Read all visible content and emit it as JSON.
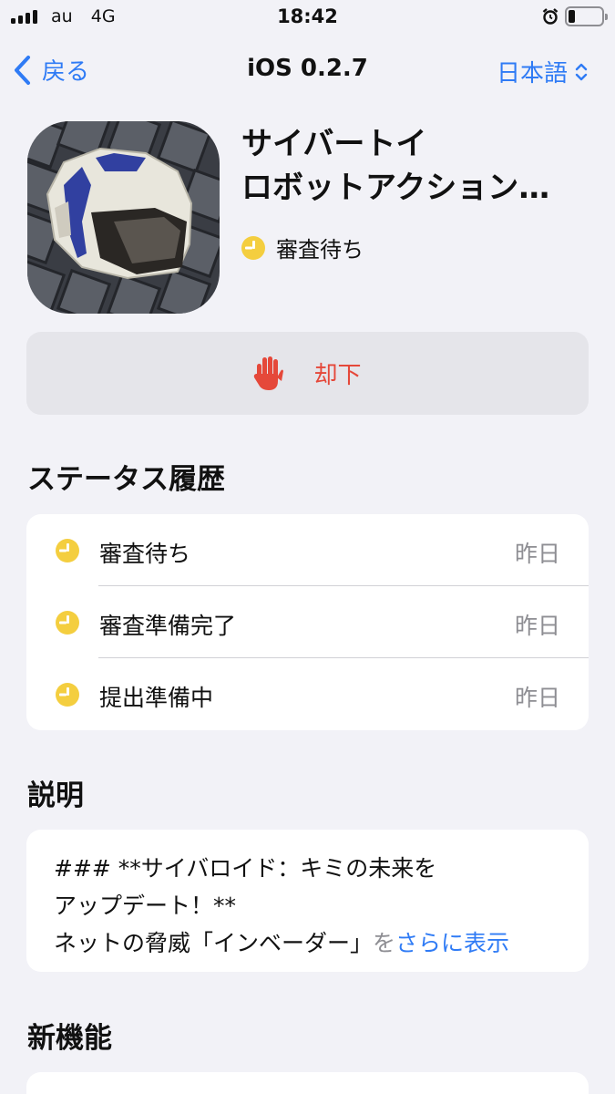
{
  "status_bar": {
    "carrier": "au",
    "network": "4G",
    "time": "18:42"
  },
  "nav": {
    "back_label": "戻る",
    "title": "iOS 0.2.7",
    "language_label": "日本語"
  },
  "app": {
    "title_line1": "サイバートイ",
    "title_line2": "ロボットアクション…",
    "status": "審査待ち"
  },
  "reject_button": {
    "label": "却下"
  },
  "status_history": {
    "heading": "ステータス履歴",
    "items": [
      {
        "label": "審査待ち",
        "date": "昨日"
      },
      {
        "label": "審査準備完了",
        "date": "昨日"
      },
      {
        "label": "提出準備中",
        "date": "昨日"
      }
    ]
  },
  "description": {
    "heading": "説明",
    "line1": "### **サイバロイド：キミの未来を",
    "line2": "アップデート！**",
    "line3": "ネットの脅威「インベーダー」",
    "line3_faded": "を",
    "more_label": "さらに表示"
  },
  "new_features": {
    "heading": "新機能"
  },
  "colors": {
    "accent": "#2f7bf5",
    "reject": "#e5483a",
    "pending": "#f4ce3f",
    "background": "#f2f2f7"
  }
}
